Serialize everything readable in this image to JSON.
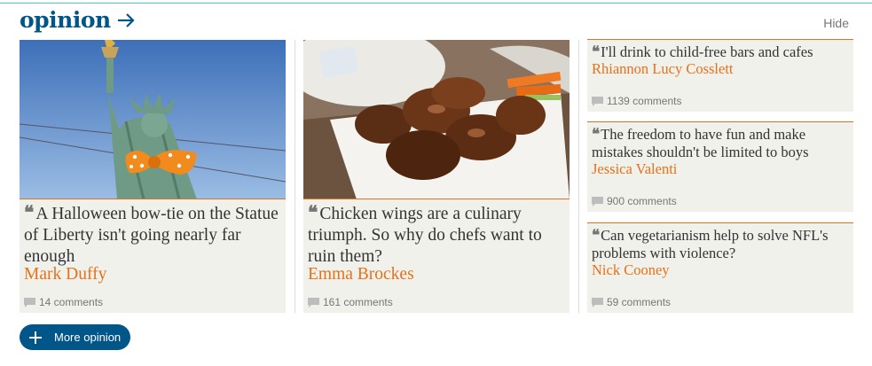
{
  "section": {
    "title": "opinion",
    "hide_label": "Hide",
    "more_label": "More opinion"
  },
  "cards": [
    {
      "headline": "A Halloween bow-tie on the Statue of Liberty isn't going nearly far enough",
      "byline": "Mark Duffy",
      "comments": "14 comments"
    },
    {
      "headline": "Chicken wings are a culinary triumph. So why do chefs want to ruin them?",
      "byline": "Emma Brockes",
      "comments": "161 comments"
    }
  ],
  "side_cards": [
    {
      "headline": "I'll drink to child-free bars and cafes",
      "byline": "Rhiannon Lucy Cosslett",
      "comments": "1139 comments"
    },
    {
      "headline": "The freedom to have fun and make mistakes shouldn't be limited to boys",
      "byline": "Jessica Valenti",
      "comments": "900 comments"
    },
    {
      "headline": "Can vegetarianism help to solve NFL's problems with violence?",
      "byline": "Nick Cooney",
      "comments": "59 comments"
    }
  ],
  "colors": {
    "brand": "#005689",
    "accent": "#e6711b",
    "card_bg": "#f1f1ec",
    "rule": "#4bc6df"
  },
  "icons": {
    "quote": "quote-icon",
    "comment": "comment-bubble-icon",
    "arrow": "arrow-right-icon",
    "plus": "plus-icon"
  },
  "quote_glyph": "❝"
}
